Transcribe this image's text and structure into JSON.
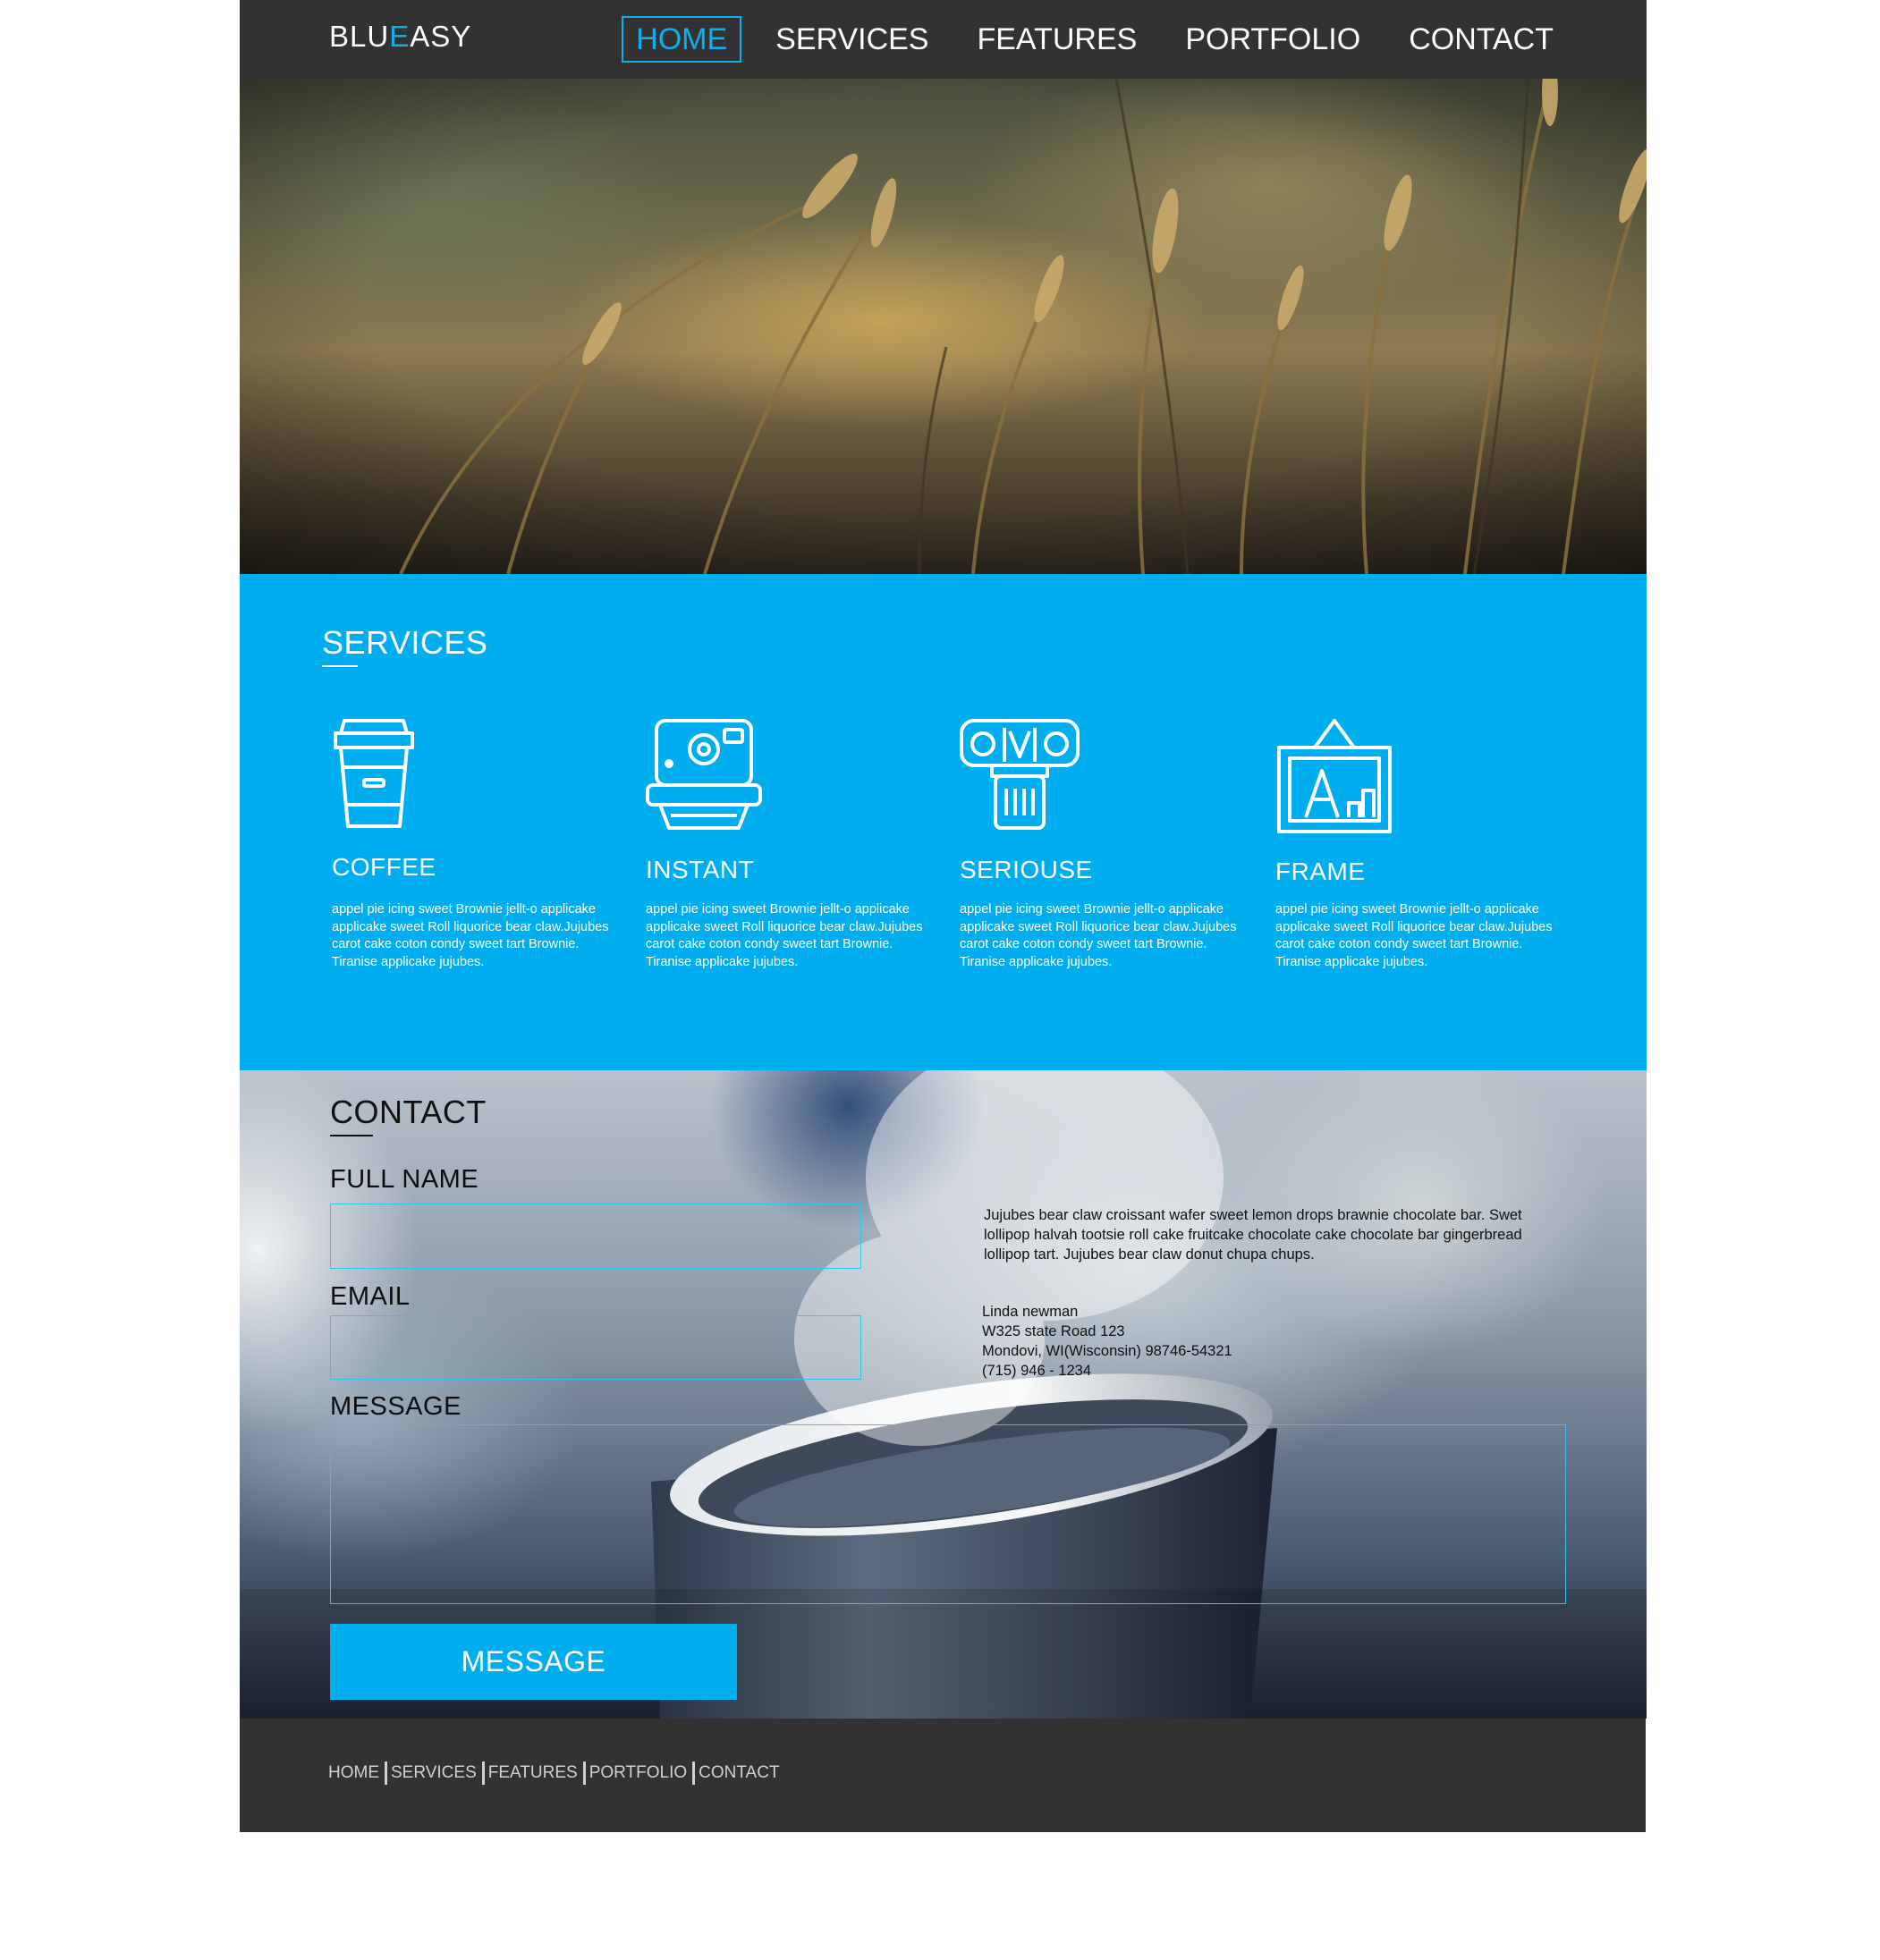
{
  "header": {
    "logo": {
      "part1": "BLU",
      "accent": "E",
      "part2": "ASY"
    },
    "nav": [
      {
        "label": "HOME",
        "active": true
      },
      {
        "label": "SERVICES",
        "active": false
      },
      {
        "label": "FEATURES",
        "active": false
      },
      {
        "label": "PORTFOLIO",
        "active": false
      },
      {
        "label": "CONTACT",
        "active": false
      }
    ]
  },
  "colors": {
    "accent": "#00adef",
    "header_bg": "#323232",
    "field_border": "#2cc7ee"
  },
  "services": {
    "title": "SERVICES",
    "items": [
      {
        "icon": "coffee-cup-icon",
        "name": "COFFEE",
        "description": "appel pie icing sweet Brownie jellt-o applicake applicake sweet Roll liquorice bear claw.Jujubes carot cake coton condy sweet tart Brownie. Tiranise applicake jujubes."
      },
      {
        "icon": "instant-camera-icon",
        "name": "INSTANT",
        "description": "appel pie icing sweet Brownie jellt-o applicake applicake sweet Roll liquorice bear claw.Jujubes carot cake coton condy sweet tart Brownie. Tiranise applicake jujubes."
      },
      {
        "icon": "film-camera-icon",
        "name": "SERIOUSE",
        "description": "appel pie icing sweet Brownie jellt-o applicake applicake sweet Roll liquorice bear claw.Jujubes carot cake coton condy sweet tart Brownie. Tiranise applicake jujubes."
      },
      {
        "icon": "picture-frame-icon",
        "name": "FRAME",
        "description": "appel pie icing sweet Brownie jellt-o applicake applicake sweet Roll liquorice bear claw.Jujubes carot cake coton condy sweet tart Brownie. Tiranise applicake jujubes."
      }
    ]
  },
  "contact": {
    "title": "CONTACT",
    "fields": {
      "full_name": {
        "label": "FULL NAME",
        "value": ""
      },
      "email": {
        "label": "EMAIL",
        "value": ""
      },
      "message": {
        "label": "MESSAGE",
        "value": ""
      }
    },
    "submit_label": "MESSAGE",
    "blurb": "Jujubes bear claw croissant wafer sweet lemon drops brawnie chocolate bar. Swet lollipop halvah tootsie roll cake fruitcake chocolate cake chocolate bar gingerbread lollipop tart. Jujubes bear claw donut chupa chups.",
    "address": {
      "name": "Linda newman",
      "street": "W325 state Road 123",
      "city": "Mondovi, WI(Wisconsin) 98746-54321",
      "phone": "(715) 946 - 1234"
    }
  },
  "footer": {
    "nav": [
      "HOME",
      "SERVICES",
      "FEATURES",
      "PORTFOLIO",
      "CONTACT"
    ]
  }
}
